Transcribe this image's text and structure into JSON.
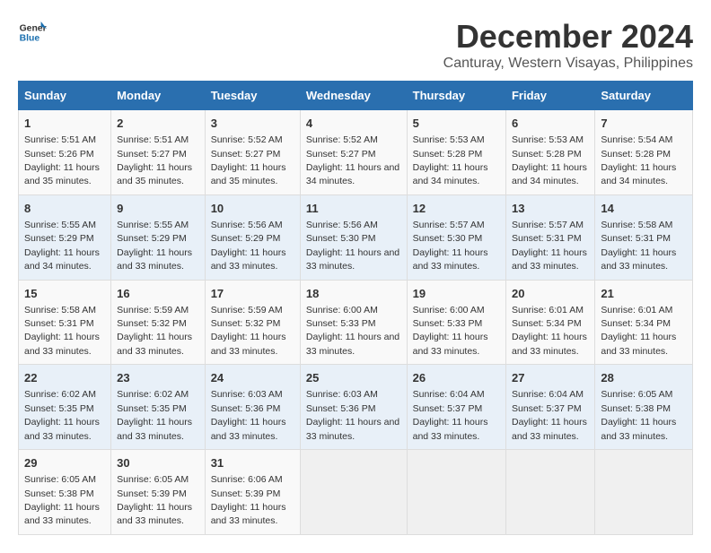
{
  "logo": {
    "general": "General",
    "blue": "Blue"
  },
  "title": "December 2024",
  "subtitle": "Canturay, Western Visayas, Philippines",
  "headers": [
    "Sunday",
    "Monday",
    "Tuesday",
    "Wednesday",
    "Thursday",
    "Friday",
    "Saturday"
  ],
  "weeks": [
    [
      {
        "day": "1",
        "sunrise": "5:51 AM",
        "sunset": "5:26 PM",
        "daylight": "11 hours and 35 minutes."
      },
      {
        "day": "2",
        "sunrise": "5:51 AM",
        "sunset": "5:27 PM",
        "daylight": "11 hours and 35 minutes."
      },
      {
        "day": "3",
        "sunrise": "5:52 AM",
        "sunset": "5:27 PM",
        "daylight": "11 hours and 35 minutes."
      },
      {
        "day": "4",
        "sunrise": "5:52 AM",
        "sunset": "5:27 PM",
        "daylight": "11 hours and 34 minutes."
      },
      {
        "day": "5",
        "sunrise": "5:53 AM",
        "sunset": "5:28 PM",
        "daylight": "11 hours and 34 minutes."
      },
      {
        "day": "6",
        "sunrise": "5:53 AM",
        "sunset": "5:28 PM",
        "daylight": "11 hours and 34 minutes."
      },
      {
        "day": "7",
        "sunrise": "5:54 AM",
        "sunset": "5:28 PM",
        "daylight": "11 hours and 34 minutes."
      }
    ],
    [
      {
        "day": "8",
        "sunrise": "5:55 AM",
        "sunset": "5:29 PM",
        "daylight": "11 hours and 34 minutes."
      },
      {
        "day": "9",
        "sunrise": "5:55 AM",
        "sunset": "5:29 PM",
        "daylight": "11 hours and 33 minutes."
      },
      {
        "day": "10",
        "sunrise": "5:56 AM",
        "sunset": "5:29 PM",
        "daylight": "11 hours and 33 minutes."
      },
      {
        "day": "11",
        "sunrise": "5:56 AM",
        "sunset": "5:30 PM",
        "daylight": "11 hours and 33 minutes."
      },
      {
        "day": "12",
        "sunrise": "5:57 AM",
        "sunset": "5:30 PM",
        "daylight": "11 hours and 33 minutes."
      },
      {
        "day": "13",
        "sunrise": "5:57 AM",
        "sunset": "5:31 PM",
        "daylight": "11 hours and 33 minutes."
      },
      {
        "day": "14",
        "sunrise": "5:58 AM",
        "sunset": "5:31 PM",
        "daylight": "11 hours and 33 minutes."
      }
    ],
    [
      {
        "day": "15",
        "sunrise": "5:58 AM",
        "sunset": "5:31 PM",
        "daylight": "11 hours and 33 minutes."
      },
      {
        "day": "16",
        "sunrise": "5:59 AM",
        "sunset": "5:32 PM",
        "daylight": "11 hours and 33 minutes."
      },
      {
        "day": "17",
        "sunrise": "5:59 AM",
        "sunset": "5:32 PM",
        "daylight": "11 hours and 33 minutes."
      },
      {
        "day": "18",
        "sunrise": "6:00 AM",
        "sunset": "5:33 PM",
        "daylight": "11 hours and 33 minutes."
      },
      {
        "day": "19",
        "sunrise": "6:00 AM",
        "sunset": "5:33 PM",
        "daylight": "11 hours and 33 minutes."
      },
      {
        "day": "20",
        "sunrise": "6:01 AM",
        "sunset": "5:34 PM",
        "daylight": "11 hours and 33 minutes."
      },
      {
        "day": "21",
        "sunrise": "6:01 AM",
        "sunset": "5:34 PM",
        "daylight": "11 hours and 33 minutes."
      }
    ],
    [
      {
        "day": "22",
        "sunrise": "6:02 AM",
        "sunset": "5:35 PM",
        "daylight": "11 hours and 33 minutes."
      },
      {
        "day": "23",
        "sunrise": "6:02 AM",
        "sunset": "5:35 PM",
        "daylight": "11 hours and 33 minutes."
      },
      {
        "day": "24",
        "sunrise": "6:03 AM",
        "sunset": "5:36 PM",
        "daylight": "11 hours and 33 minutes."
      },
      {
        "day": "25",
        "sunrise": "6:03 AM",
        "sunset": "5:36 PM",
        "daylight": "11 hours and 33 minutes."
      },
      {
        "day": "26",
        "sunrise": "6:04 AM",
        "sunset": "5:37 PM",
        "daylight": "11 hours and 33 minutes."
      },
      {
        "day": "27",
        "sunrise": "6:04 AM",
        "sunset": "5:37 PM",
        "daylight": "11 hours and 33 minutes."
      },
      {
        "day": "28",
        "sunrise": "6:05 AM",
        "sunset": "5:38 PM",
        "daylight": "11 hours and 33 minutes."
      }
    ],
    [
      {
        "day": "29",
        "sunrise": "6:05 AM",
        "sunset": "5:38 PM",
        "daylight": "11 hours and 33 minutes."
      },
      {
        "day": "30",
        "sunrise": "6:05 AM",
        "sunset": "5:39 PM",
        "daylight": "11 hours and 33 minutes."
      },
      {
        "day": "31",
        "sunrise": "6:06 AM",
        "sunset": "5:39 PM",
        "daylight": "11 hours and 33 minutes."
      },
      null,
      null,
      null,
      null
    ]
  ]
}
